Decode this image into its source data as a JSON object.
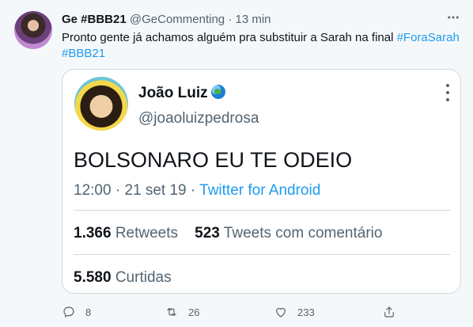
{
  "tweet": {
    "author_name": "Ge #BBB21",
    "author_handle": "@GeCommenting",
    "separator": "·",
    "time": "13 min",
    "text_plain": "Pronto gente já achamos alguém pra substituir a Sarah na final ",
    "hashtag_1": "#ForaSarah",
    "hashtag_2": "#BBB21",
    "avatar_icon": "user-avatar-photo",
    "more_icon": "more-horizontal-icon"
  },
  "quoted": {
    "name": "João Luiz",
    "handle": "@joaoluizpedrosa",
    "badge_icon": "globe-emoji",
    "text": "BOLSONARO EU TE ODEIO",
    "time": "12:00",
    "sep1": "·",
    "date": "21 set 19",
    "sep2": "·",
    "source": "Twitter for Android",
    "retweets_count": "1.366",
    "retweets_label": "Retweets",
    "quote_count": "523",
    "quote_label": "Tweets com comentário",
    "likes_count": "5.580",
    "likes_label": "Curtidas"
  },
  "actions": {
    "reply_count": "8",
    "retweet_count": "26",
    "like_count": "233"
  },
  "colors": {
    "accent": "#1d9bf0",
    "text": "#0f1419",
    "muted": "#536471",
    "border": "#cfd9de"
  }
}
